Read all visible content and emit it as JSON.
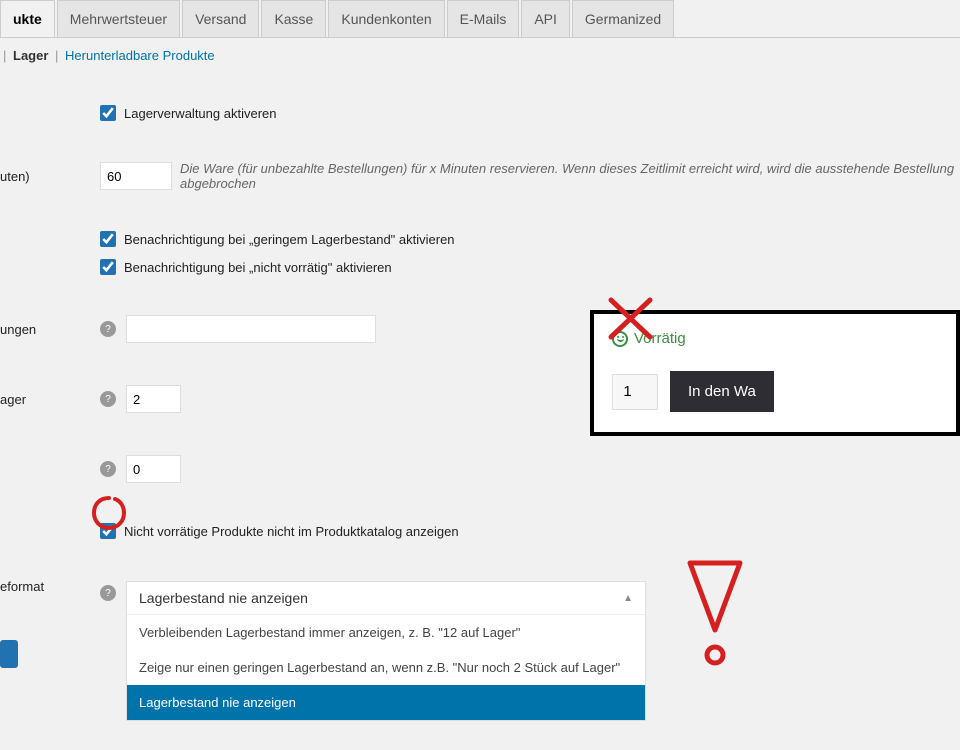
{
  "tabs": {
    "items": [
      "ukte",
      "Mehrwertsteuer",
      "Versand",
      "Kasse",
      "Kundenkonten",
      "E-Mails",
      "API",
      "Germanized"
    ],
    "active_index": 0
  },
  "subtabs": {
    "current": "Lager",
    "link": "Herunterladbare Produkte"
  },
  "checkboxes": {
    "activate_stock": "Lagerverwaltung aktiveren",
    "low_stock_notify": "Benachrichtigung bei „geringem Lagerbestand\" aktivieren",
    "out_of_stock_notify": "Benachrichtigung bei „nicht vorrätig\" aktivieren",
    "hide_oos": "Nicht vorrätige Produkte nicht im Produktkatalog anzeigen"
  },
  "rows": {
    "hold_minutes": {
      "label": "uten)",
      "value": "60",
      "desc": "Die Ware (für unbezahlte Bestellungen) für x Minuten reservieren. Wenn dieses Zeitlimit erreicht wird, wird die ausstehende Bestellung abgebrochen"
    },
    "notifications_label": "ungen",
    "low_threshold_label": "ager",
    "low_threshold_value": "2",
    "zero_value": "0",
    "format_label": "eformat"
  },
  "select": {
    "current": "Lagerbestand nie anzeigen",
    "options": [
      "Verbleibenden Lagerbestand immer anzeigen, z. B. \"12 auf Lager\"",
      "Zeige nur einen geringen Lagerbestand an, wenn z.B. \"Nur noch 2 Stück auf Lager\"",
      "Lagerbestand nie anzeigen"
    ]
  },
  "preview": {
    "stock_text": "Vorrätig",
    "qty": "1",
    "button": "In den Wa"
  },
  "help_glyph": "?"
}
